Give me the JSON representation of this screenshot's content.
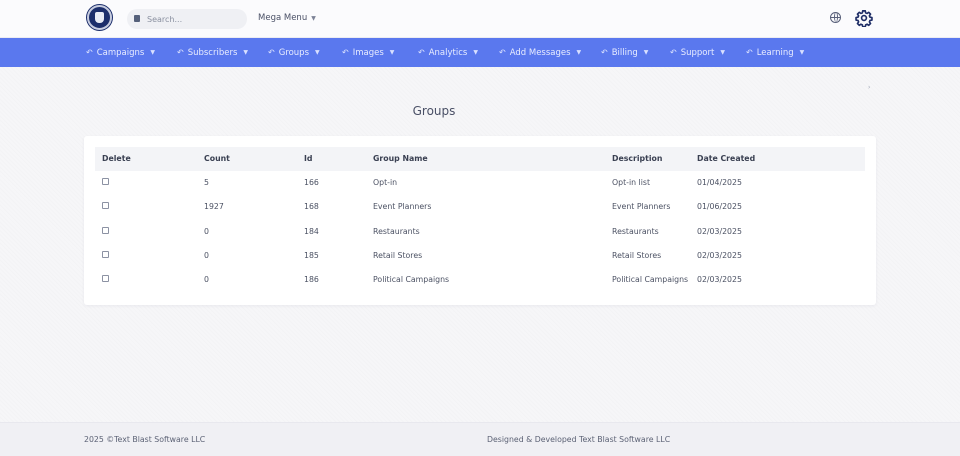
{
  "header": {
    "search_placeholder": "Search...",
    "mega_menu_label": "Mega Menu"
  },
  "nav": {
    "items": [
      {
        "label": "Campaigns"
      },
      {
        "label": "Subscribers"
      },
      {
        "label": "Groups"
      },
      {
        "label": "Images"
      },
      {
        "label": "Analytics"
      },
      {
        "label": "Add Messages"
      },
      {
        "label": "Billing"
      },
      {
        "label": "Support"
      },
      {
        "label": "Learning"
      }
    ]
  },
  "main": {
    "title": "Groups",
    "table": {
      "columns": [
        "Delete",
        "Count",
        "Id",
        "Group Name",
        "Description",
        "Date Created"
      ],
      "rows": [
        {
          "count": "5",
          "id": "166",
          "name": "Opt-in",
          "description": "Opt-in list",
          "date": "01/04/2025"
        },
        {
          "count": "1927",
          "id": "168",
          "name": "Event Planners",
          "description": "Event Planners",
          "date": "01/06/2025"
        },
        {
          "count": "0",
          "id": "184",
          "name": "Restaurants",
          "description": "Restaurants",
          "date": "02/03/2025"
        },
        {
          "count": "0",
          "id": "185",
          "name": "Retail Stores",
          "description": "Retail Stores",
          "date": "02/03/2025"
        },
        {
          "count": "0",
          "id": "186",
          "name": "Political Campaigns",
          "description": "Political Campaigns",
          "date": "02/03/2025"
        }
      ]
    }
  },
  "footer": {
    "left": "2025 ©Text Blast Software LLC",
    "right": "Designed & Developed Text Blast Software LLC"
  },
  "colors": {
    "nav_background": "#5a78ee",
    "accent_dark": "#1e2d66"
  },
  "icons": {
    "logo": "logo-badge",
    "search": "search-icon",
    "globe": "globe-icon",
    "settings": "gear-icon",
    "nav_item": "arrow-icon"
  }
}
